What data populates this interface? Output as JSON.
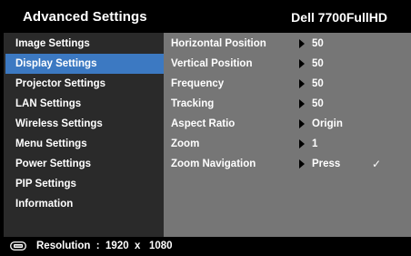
{
  "header": {
    "title": "Advanced Settings",
    "model": "Dell 7700FullHD"
  },
  "sidebar": {
    "selected_index": 1,
    "items": [
      {
        "label": "Image Settings"
      },
      {
        "label": "Display Settings"
      },
      {
        "label": "Projector Settings"
      },
      {
        "label": "LAN Settings"
      },
      {
        "label": "Wireless Settings"
      },
      {
        "label": "Menu Settings"
      },
      {
        "label": "Power Settings"
      },
      {
        "label": "PIP Settings"
      },
      {
        "label": "Information"
      }
    ]
  },
  "panel": {
    "rows": [
      {
        "label": "Horizontal Position",
        "value": "50",
        "check": ""
      },
      {
        "label": "Vertical Position",
        "value": "50",
        "check": ""
      },
      {
        "label": "Frequency",
        "value": "50",
        "check": ""
      },
      {
        "label": "Tracking",
        "value": "50",
        "check": ""
      },
      {
        "label": "Aspect Ratio",
        "value": "Origin",
        "check": ""
      },
      {
        "label": "Zoom",
        "value": "1",
        "check": ""
      },
      {
        "label": "Zoom Navigation",
        "value": "Press",
        "check": "✓"
      }
    ]
  },
  "footer": {
    "icon": "monitor-icon",
    "resolution_text": "Resolution  :  1920  x   1080"
  },
  "colors": {
    "selected": "#3c79c2",
    "sidebar_bg": "#2a2a2a",
    "panel_bg": "#767676"
  }
}
